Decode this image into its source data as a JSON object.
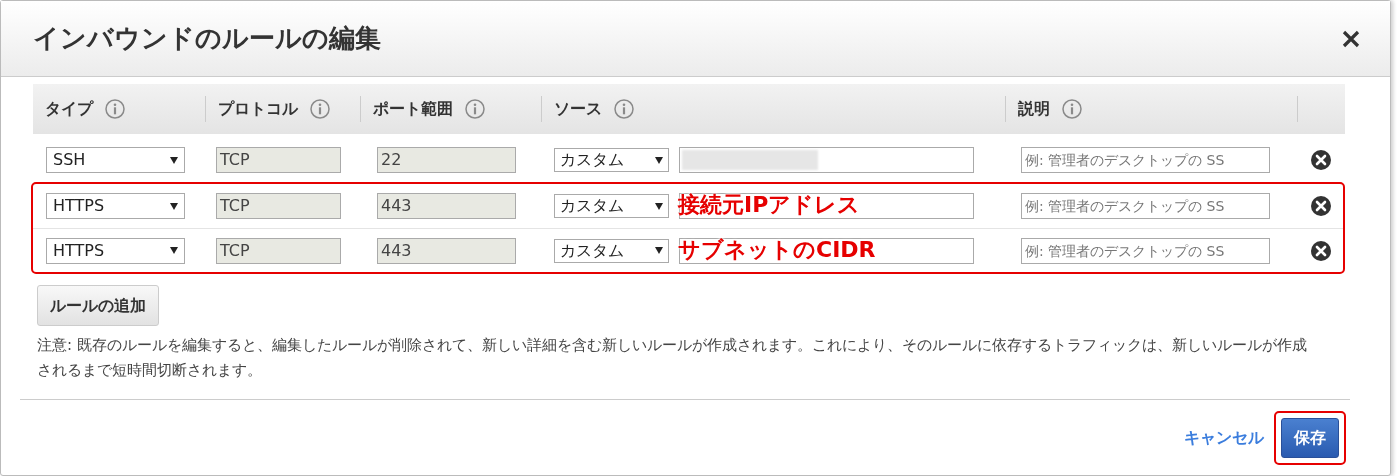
{
  "dialog": {
    "title": "インバウンドのルールの編集"
  },
  "columns": [
    "タイプ",
    "プロトコル",
    "ポート範囲",
    "ソース",
    "説明"
  ],
  "rows": [
    {
      "type": "SSH",
      "protocol": "TCP",
      "port": "22",
      "source_mode": "カスタム",
      "source_redacted": true,
      "description_placeholder": "例: 管理者のデスクトップの SS",
      "highlighted": false
    },
    {
      "type": "HTTPS",
      "protocol": "TCP",
      "port": "443",
      "source_mode": "カスタム",
      "source_redacted": false,
      "annotation": "接続元IPアドレス",
      "description_placeholder": "例: 管理者のデスクトップの SS",
      "highlighted": true
    },
    {
      "type": "HTTPS",
      "protocol": "TCP",
      "port": "443",
      "source_mode": "カスタム",
      "source_redacted": false,
      "annotation": "サブネットのCIDR",
      "description_placeholder": "例: 管理者のデスクトップの SS",
      "highlighted": true
    }
  ],
  "add_rule_button": "ルールの追加",
  "note": "注意: 既存のルールを編集すると、編集したルールが削除されて、新しい詳細を含む新しいルールが作成されます。これにより、そのルールに依存するトラフィックは、新しいルールが作成されるまで短時間切断されます。",
  "footer": {
    "cancel": "キャンセル",
    "save": "保存",
    "save_highlighted": true
  }
}
